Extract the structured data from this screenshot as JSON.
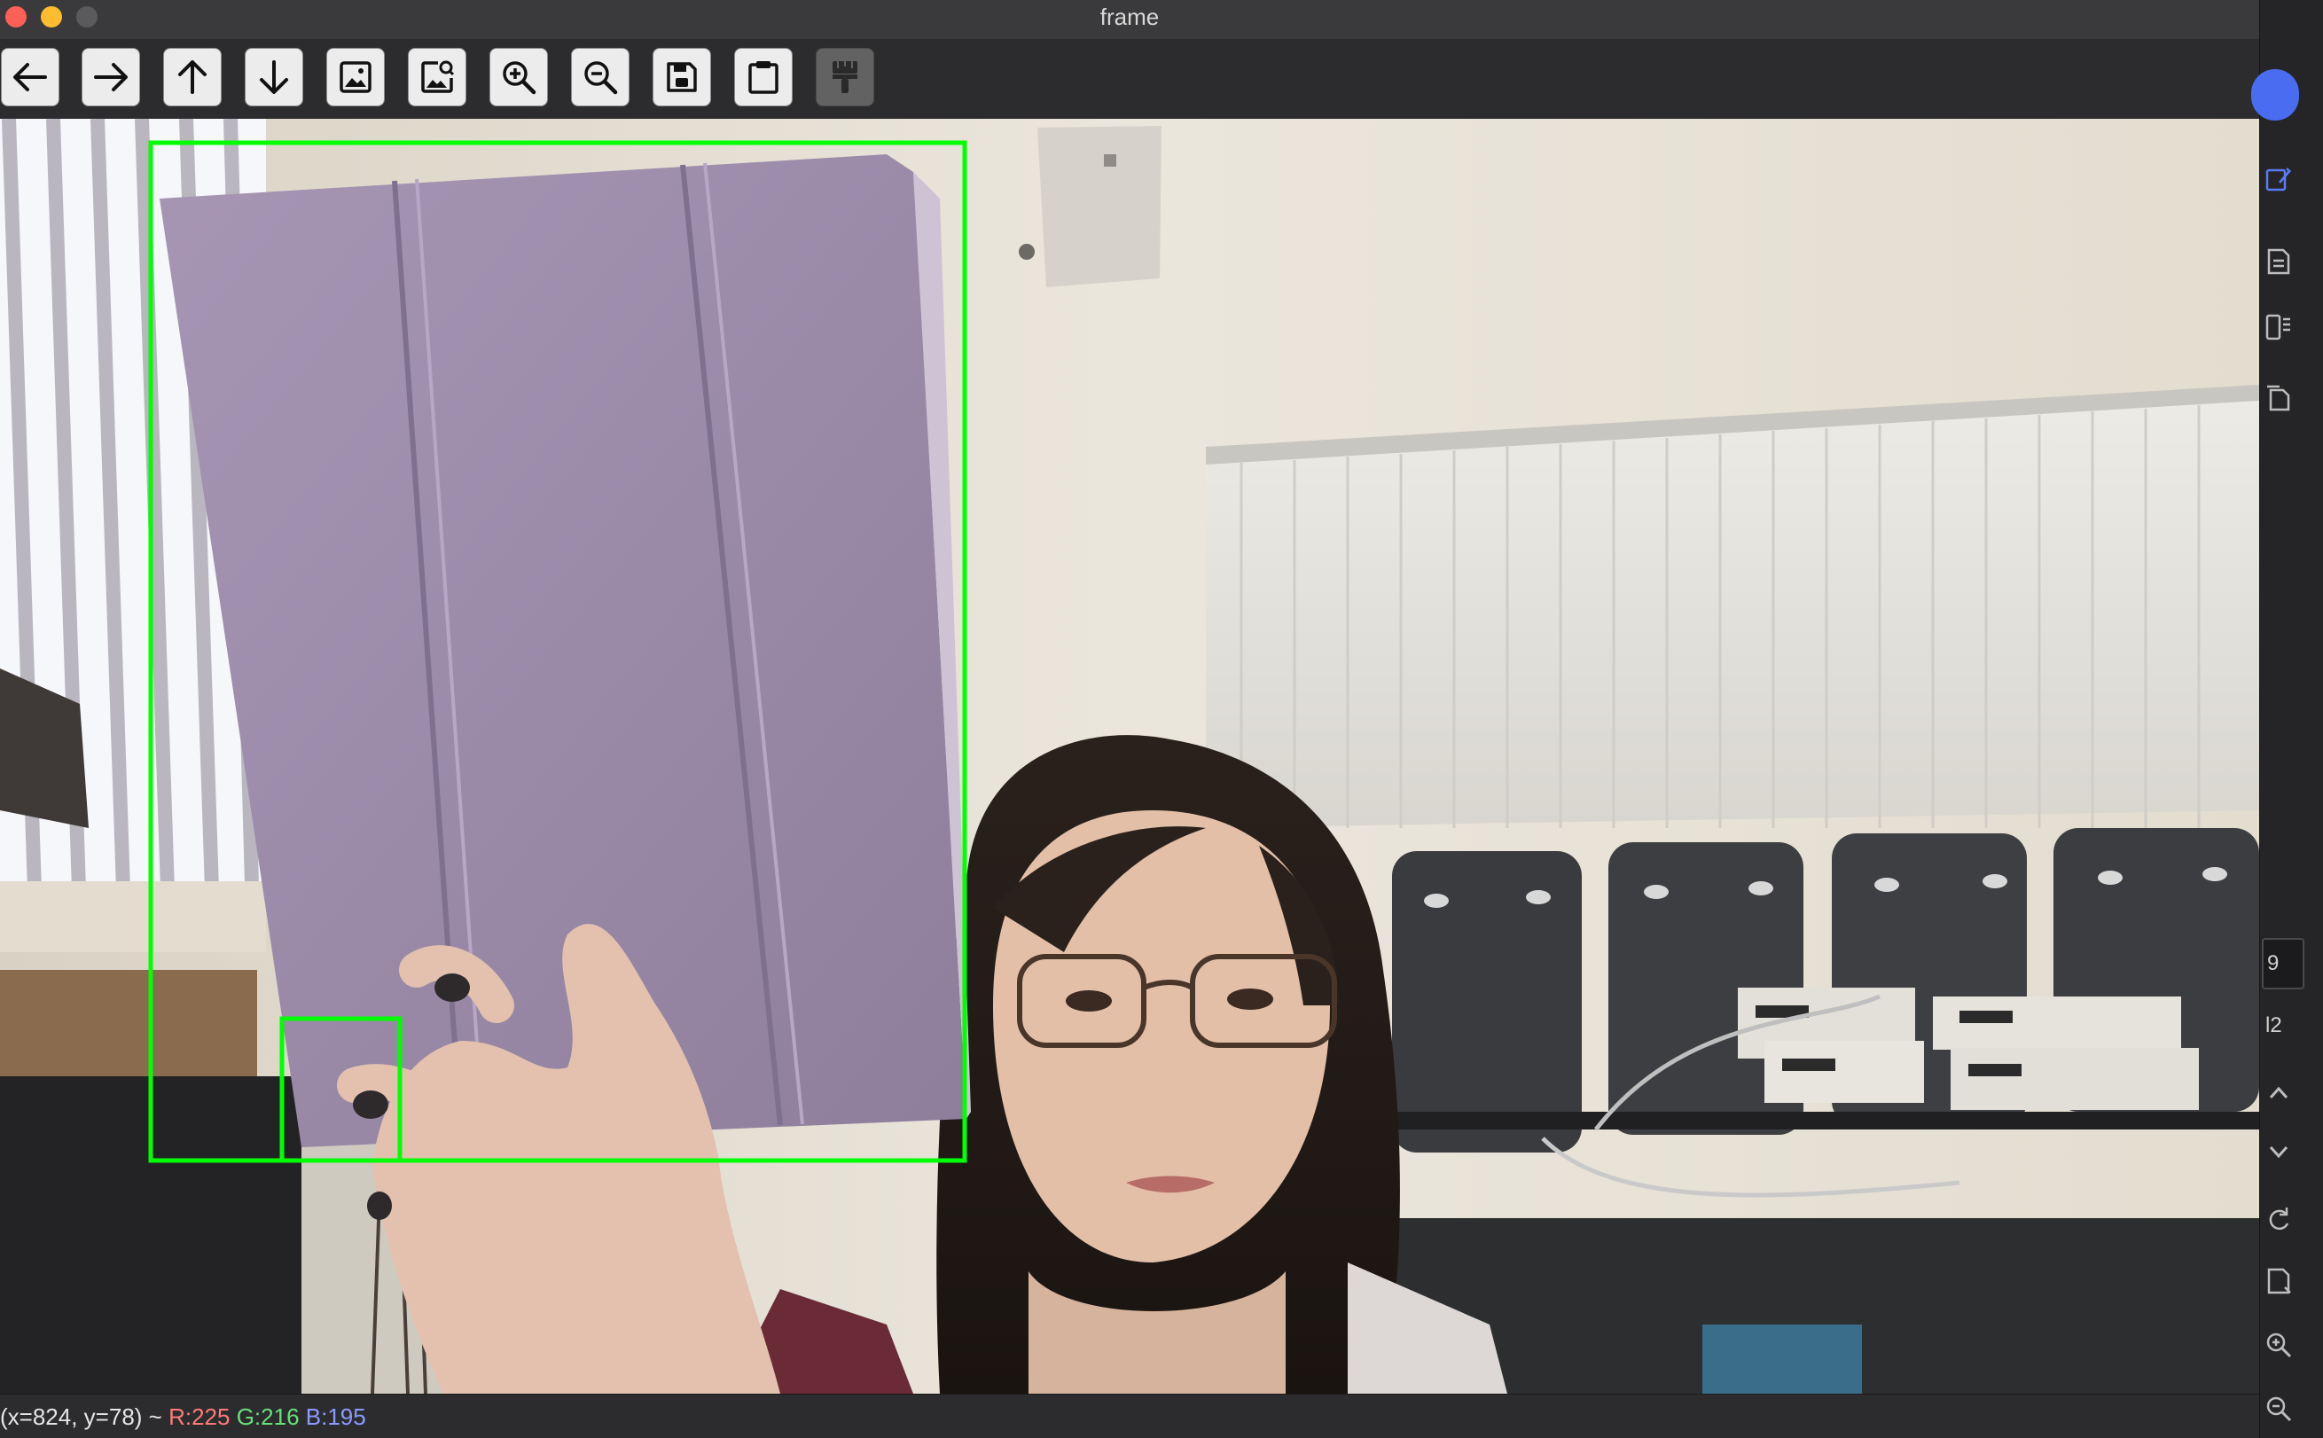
{
  "window": {
    "title": "frame"
  },
  "toolbar": {
    "buttons": [
      {
        "name": "back",
        "icon": "arrow-left-icon"
      },
      {
        "name": "forward",
        "icon": "arrow-right-icon"
      },
      {
        "name": "up",
        "icon": "arrow-up-icon"
      },
      {
        "name": "down",
        "icon": "arrow-down-icon"
      },
      {
        "name": "image",
        "icon": "image-icon"
      },
      {
        "name": "image-zoom",
        "icon": "image-magnifier-icon"
      },
      {
        "name": "zoom-in",
        "icon": "zoom-in-icon"
      },
      {
        "name": "zoom-out",
        "icon": "zoom-out-icon"
      },
      {
        "name": "save",
        "icon": "floppy-disk-icon"
      },
      {
        "name": "copy-to-clipboard",
        "icon": "clipboard-icon"
      },
      {
        "name": "properties",
        "icon": "paint-brush-icon",
        "disabled": true
      }
    ]
  },
  "status": {
    "coords": "(x=824, y=78) ~",
    "r": "R:225",
    "g": "G:216",
    "b": "B:195"
  },
  "sidepanel": {
    "box_text": "9",
    "line_text": "l2"
  },
  "colors": {
    "box_outline": "#00ff00",
    "tablet": "#9a88a8",
    "wall": "#e9e4da"
  }
}
